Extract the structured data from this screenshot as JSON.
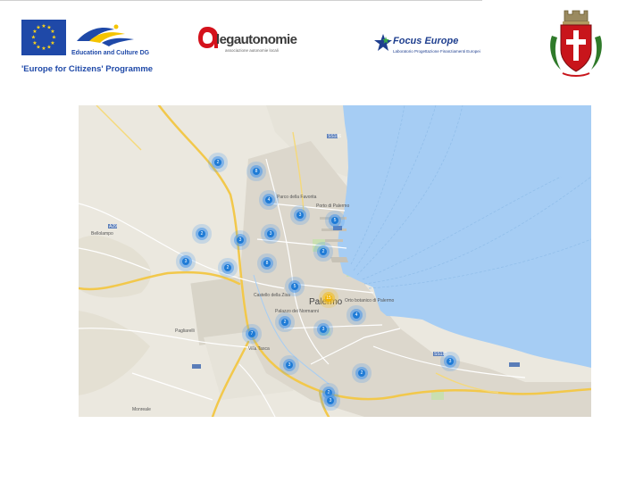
{
  "header": {
    "eu": {
      "program_label": "Education and Culture DG",
      "caption": "'Europe for Citizens' Programme"
    },
    "lega": {
      "name": "legautonomie",
      "subtitle": "associazione autonomie locali"
    },
    "focus": {
      "name": "Focus Europe",
      "subtitle": "Laboratorio Progettazione Finanziamenti Europei"
    },
    "crest_icon": "city-coat-of-arms-icon"
  },
  "map": {
    "places": {
      "city": "Palermo",
      "bellolampo": "Bellolampo",
      "monreale": "Monreale",
      "palazzo_normanni": "Palazzo dei Normanni",
      "castello_ziza": "Castello della Zisa",
      "orto_botanico": "Orto botanico di Palermo",
      "parco_favorita": "Parco della Favorita",
      "pagliarelli": "Pagliarelli",
      "villa_tasca": "Villa Tasca",
      "porto": "Porto di Palermo",
      "route_a29": "A29",
      "route_ss113": "SS113",
      "route_ss186": "SS186"
    },
    "clusters": [
      "2",
      "8",
      "4",
      "3",
      "5",
      "2",
      "3",
      "3",
      "2",
      "3",
      "8",
      "2",
      "5",
      "15",
      "4",
      "2",
      "3",
      "7",
      "3",
      "3",
      "2",
      "2",
      "3"
    ],
    "colors": {
      "water": "#a6cdf4",
      "land": "#ebe8df",
      "urban": "#dcd7cc",
      "major_road": "#f2c84b",
      "cluster": "#1e7bd6",
      "cluster_hot": "#f2b400"
    }
  }
}
